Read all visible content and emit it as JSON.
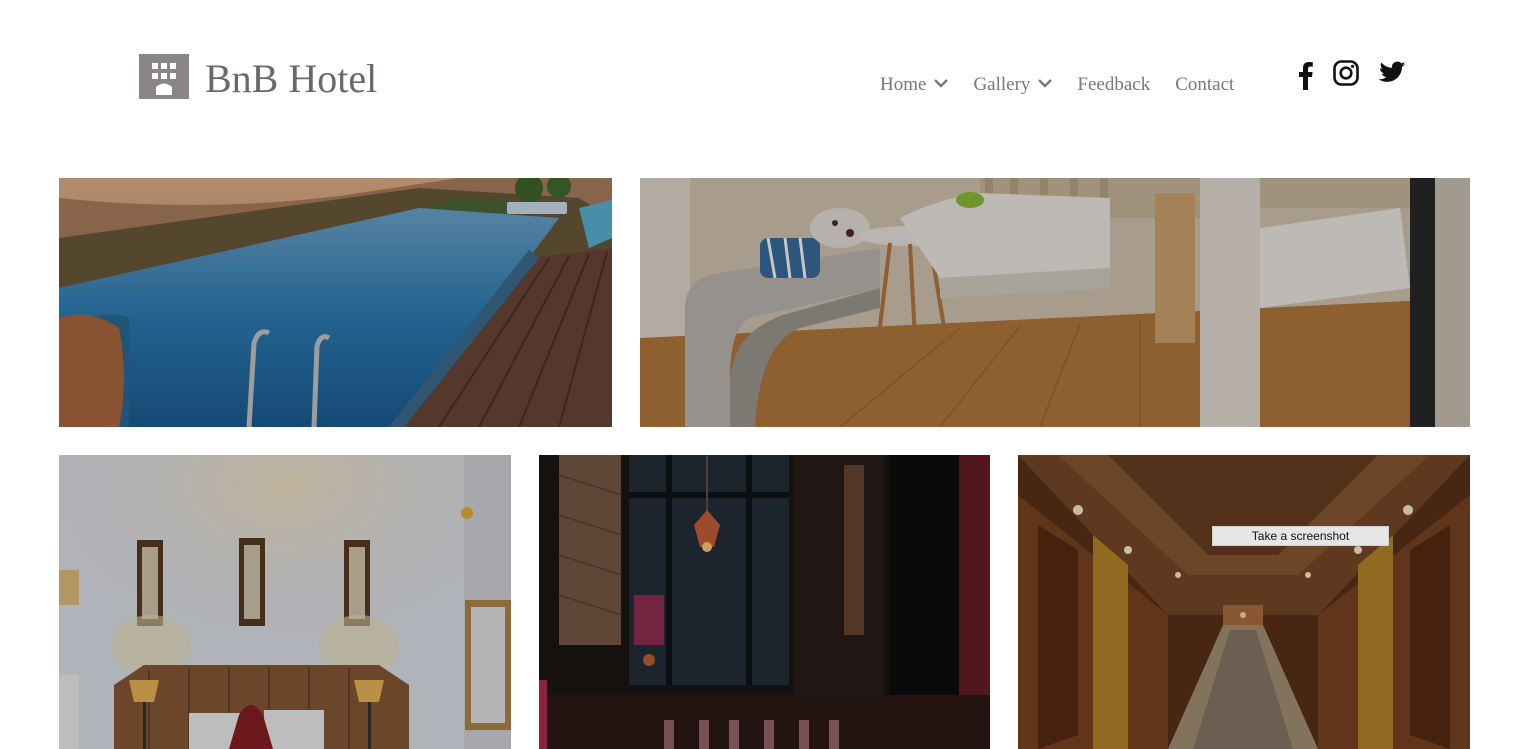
{
  "brand": {
    "name": "BnB Hotel",
    "icon": "hotel-building-icon",
    "color": "#8a8686"
  },
  "nav": {
    "items": [
      {
        "label": "Home",
        "dropdown": true
      },
      {
        "label": "Gallery",
        "dropdown": true
      },
      {
        "label": "Feedback",
        "dropdown": false
      },
      {
        "label": "Contact",
        "dropdown": false
      }
    ]
  },
  "social": {
    "icons": [
      "facebook-icon",
      "instagram-icon",
      "twitter-icon"
    ]
  },
  "gallery": {
    "images": [
      "infinity-pool",
      "hotel-room",
      "bedroom",
      "bar-lounge",
      "hotel-corridor"
    ]
  },
  "overlay": {
    "screenshot_label": "Take a screenshot"
  }
}
